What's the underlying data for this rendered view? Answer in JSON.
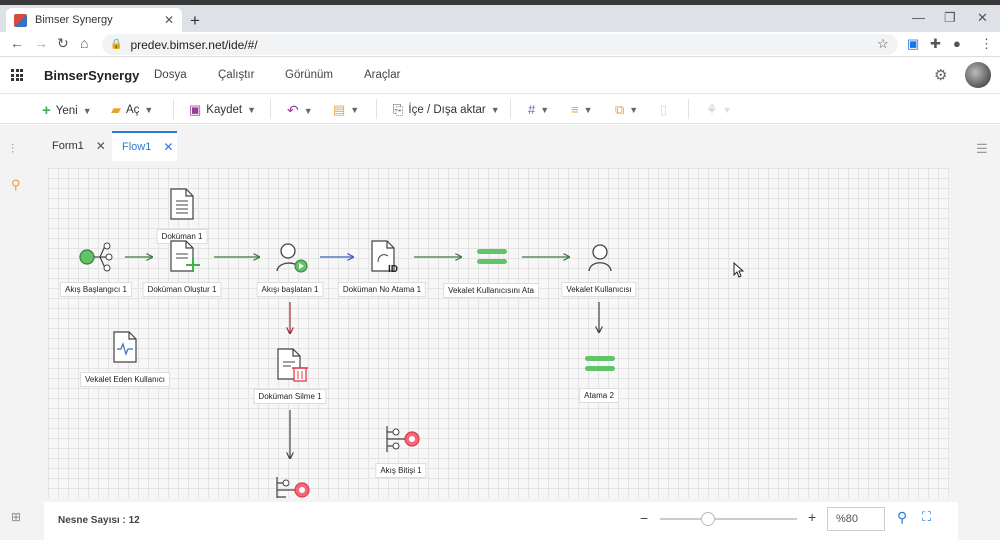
{
  "browser": {
    "tab_title": "Bimser Synergy",
    "new_tab": "+",
    "tab_close": "✕",
    "url": "predev.bimser.net/ide/#/",
    "win_min": "—",
    "win_max": "❐",
    "win_close": "✕"
  },
  "app": {
    "brand": "BimserSynergy",
    "menu": [
      "Dosya",
      "Çalıştır",
      "Görünüm",
      "Araçlar"
    ]
  },
  "toolbar": {
    "new_label": "Yeni",
    "open_label": "Aç",
    "save_label": "Kaydet",
    "import_export_label": "İçe / Dışa aktar"
  },
  "doc_tabs": [
    {
      "label": "Form1"
    },
    {
      "label": "Flow1",
      "active": true
    }
  ],
  "nodes": [
    {
      "label": "Doküman 1"
    },
    {
      "label": "Akış Başlangıcı 1"
    },
    {
      "label": "Doküman Oluştur 1"
    },
    {
      "label": "Akışı başlatan 1"
    },
    {
      "label": "Doküman No Atama 1"
    },
    {
      "label": "Vekalet Kullanıcısını Ata"
    },
    {
      "label": "Vekalet Kullanıcısı"
    },
    {
      "label": "Vekalet Eden Kullanıcı"
    },
    {
      "label": "Doküman Silme 1"
    },
    {
      "label": "Atama 2"
    },
    {
      "label": "Akış Bitişi 1"
    }
  ],
  "status": {
    "object_count": "Nesne Sayısı : 12",
    "zoom_minus": "−",
    "zoom_plus": "+",
    "zoom_level": "%80"
  },
  "colors": {
    "accent": "#2a7bd4",
    "green": "#3bb54a",
    "red": "#e23b4a"
  }
}
